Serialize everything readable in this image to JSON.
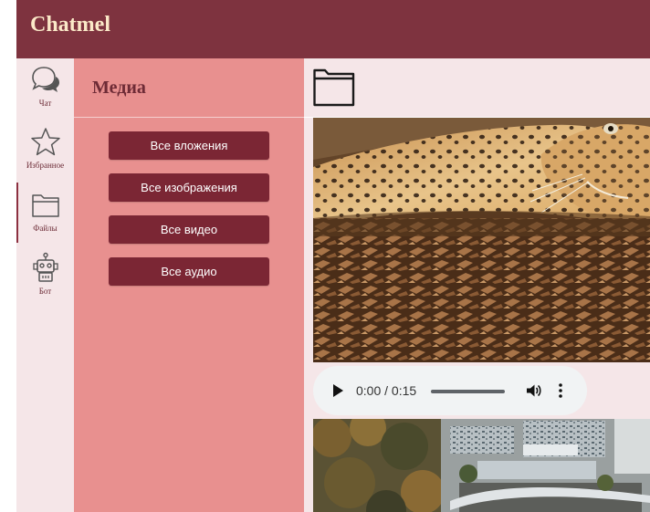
{
  "app": {
    "title": "Chatmel"
  },
  "rail": {
    "items": [
      {
        "label": "Чат",
        "icon": "chat-bubbles-icon"
      },
      {
        "label": "Избранное",
        "icon": "star-icon"
      },
      {
        "label": "Файлы",
        "icon": "folder-icon",
        "active": true
      },
      {
        "label": "Бот",
        "icon": "robot-icon"
      }
    ]
  },
  "panel": {
    "title": "Медиа",
    "buttons": [
      {
        "label": "Все вложения"
      },
      {
        "label": "Все изображения"
      },
      {
        "label": "Все видео"
      },
      {
        "label": "Все аудио"
      }
    ]
  },
  "content": {
    "header_icon": "folder-icon",
    "media": [
      {
        "type": "image",
        "subject": "leopard"
      },
      {
        "type": "audio",
        "time": "0:00 / 0:15",
        "progress": 0
      },
      {
        "type": "image",
        "subject": "city"
      }
    ]
  },
  "colors": {
    "header": "#7e333f",
    "title_text": "#fbe9c8",
    "panel_bg": "#e8908f",
    "button_bg": "#7b2634",
    "rail_bg": "#f5e6e8"
  }
}
